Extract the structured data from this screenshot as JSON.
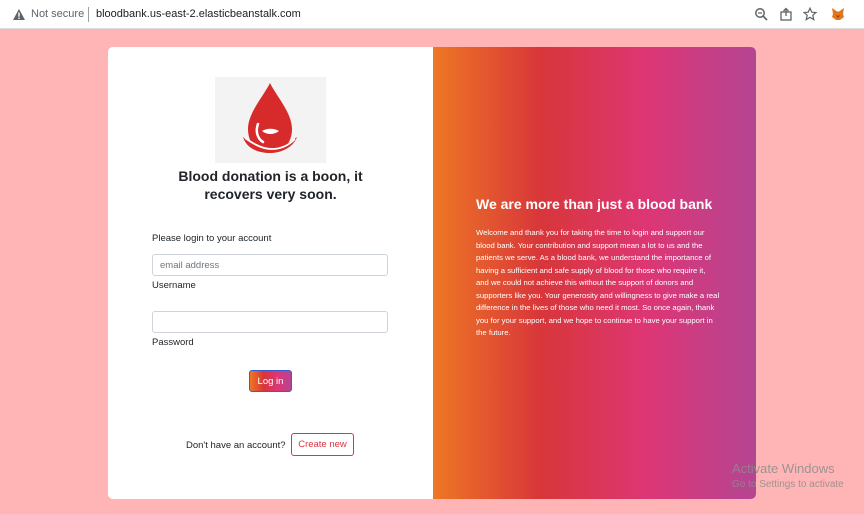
{
  "browser": {
    "security_label": "Not secure",
    "url": "bloodbank.us-east-2.elasticbeanstalk.com"
  },
  "login": {
    "tagline_line1": "Blood donation is a boon, it",
    "tagline_line2": "recovers very soon.",
    "prompt": "Please login to your account",
    "email_placeholder": "email address",
    "username_label": "Username",
    "password_label": "Password",
    "login_button": "Log in",
    "signup_prompt": "Don't have an account?",
    "create_button": "Create new"
  },
  "hero": {
    "heading": "We are more than just a blood bank",
    "body": "Welcome and thank you for taking the time to login and support our blood bank. Your contribution and support mean a lot to us and the patients we serve. As a blood bank, we understand the importance of having a sufficient and safe supply of blood for those who require it, and we could not achieve this without the support of donors and supporters like you. Your generosity and willingness to give make a real difference in the lives of those who need it most. So once again, thank you for your support, and we hope to continue to have your support in the future."
  },
  "watermark": {
    "title": "Activate Windows",
    "subtitle": "Go to Settings to activate"
  },
  "colors": {
    "page_background": "#ffb5b5",
    "gradient": [
      "#ee7724",
      "#d8363a",
      "#dd3675",
      "#b44593"
    ],
    "blood_red": "#d72a2a",
    "create_button": "#dc3545"
  },
  "icons": {
    "warning": "warning-triangle-icon",
    "zoom": "zoom-icon",
    "share": "share-icon",
    "bookmark": "star-icon",
    "extension": "metamask-fox-icon",
    "logo": "blood-drop-hand-logo"
  }
}
